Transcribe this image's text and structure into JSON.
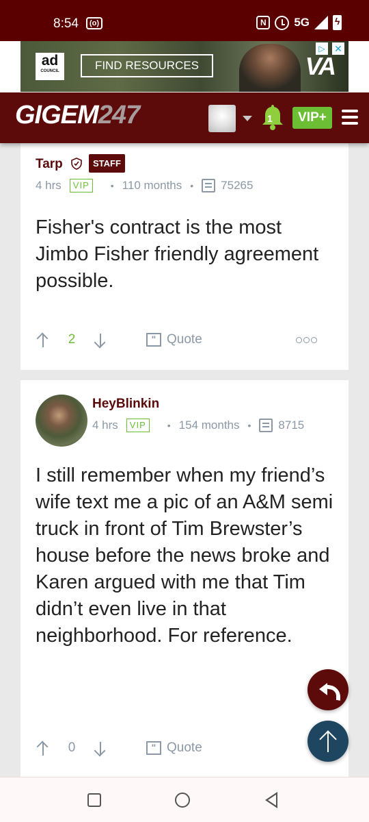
{
  "status_bar": {
    "time": "8:54",
    "cast": "(o)",
    "nfc": "N",
    "network": "5G"
  },
  "ad": {
    "logo_big": "ad",
    "logo_small": "COUNCIL",
    "cta": "FIND RESOURCES",
    "brand": "VA",
    "info": "▷",
    "close": "✕"
  },
  "header": {
    "logo_text": "GIGEM",
    "logo_num": "247",
    "notification_count": "1",
    "vip_label": "VIP+"
  },
  "posts": [
    {
      "username": "Tarp",
      "badge": "STAFF",
      "time": "4 hrs",
      "vip": "VIP",
      "tenure": "110 months",
      "post_count": "75265",
      "body": "Fisher's contract is the most Jimbo Fisher friendly agreement possible.",
      "score": "2",
      "quote_label": "Quote"
    },
    {
      "username": "HeyBlinkin",
      "time": "4 hrs",
      "vip": "VIP",
      "tenure": "154 months",
      "post_count": "8715",
      "body": "I still remember when my friend’s wife text me a pic of an A&M semi truck in front of Tim Brewster’s house before the news broke and Karen argued with me that Tim didn’t even live in that neighborhood. For reference.",
      "score": "0",
      "quote_label": "Quote"
    }
  ],
  "colors": {
    "brand_maroon": "#5c0a0a",
    "vip_green": "#6cbf34",
    "meta_gray": "#8b98a5",
    "scroll_top_blue": "#1e4660"
  }
}
